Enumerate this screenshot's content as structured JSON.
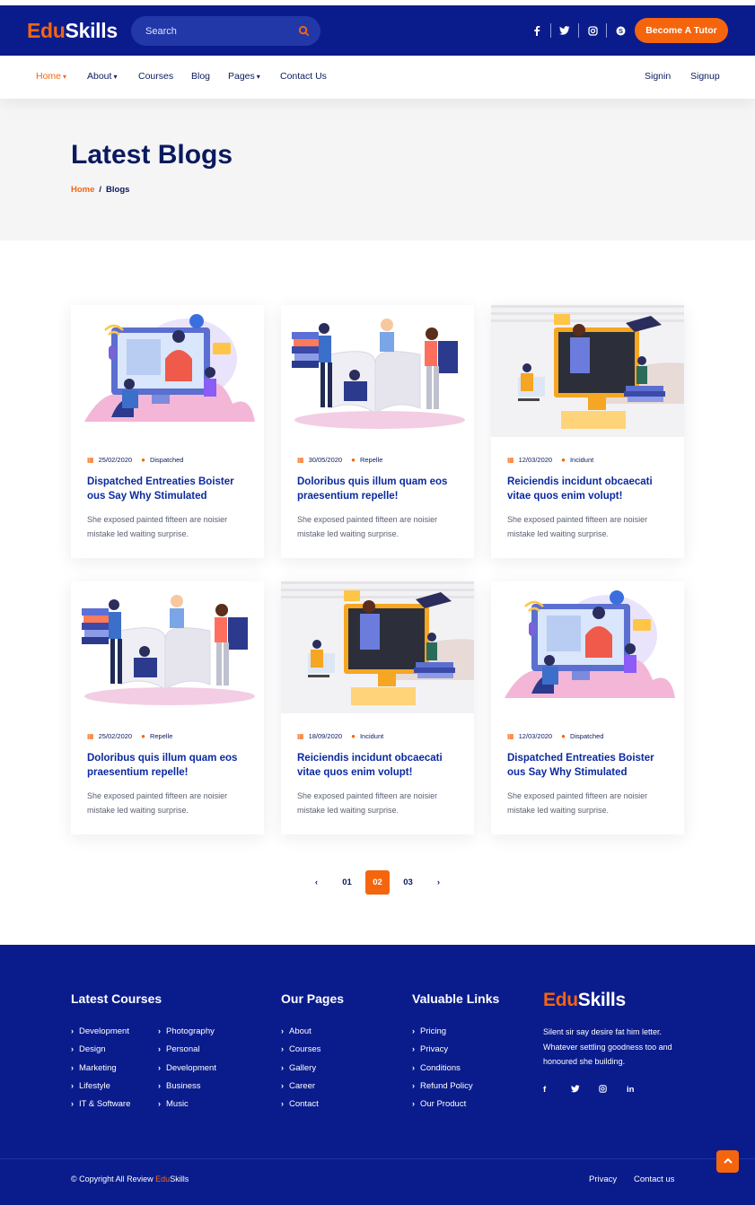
{
  "brand": {
    "edu": "Edu",
    "skills": "Skills"
  },
  "search": {
    "placeholder": "Search"
  },
  "header": {
    "social": [
      "f",
      "t",
      "o",
      "s"
    ],
    "tutor_button": "Become A Tutor"
  },
  "nav": {
    "items": [
      "Home",
      "About",
      "Courses",
      "Blog",
      "Pages",
      "Contact Us"
    ],
    "signin": "Signin",
    "signup": "Signup"
  },
  "hero": {
    "title": "Latest Blogs",
    "breadcrumb_home": "Home",
    "breadcrumb_sep": "/",
    "breadcrumb_current": "Blogs"
  },
  "posts": [
    {
      "date": "25/02/2020",
      "author": "Dispatched",
      "title": "Dispatched Entreaties Boister ous Say Why Stimulated",
      "excerpt": "She exposed painted fifteen are noisier mistake led waiting surprise."
    },
    {
      "date": "30/05/2020",
      "author": "Repelle",
      "title": "Doloribus quis illum quam eos praesentium repelle!",
      "excerpt": "She exposed painted fifteen are noisier mistake led waiting surprise."
    },
    {
      "date": "12/03/2020",
      "author": "Incidunt",
      "title": "Reiciendis incidunt obcaecati vitae quos enim volupt!",
      "excerpt": "She exposed painted fifteen are noisier mistake led waiting surprise."
    },
    {
      "date": "25/02/2020",
      "author": "Repelle",
      "title": "Doloribus quis illum quam eos praesentium repelle!",
      "excerpt": "She exposed painted fifteen are noisier mistake led waiting surprise."
    },
    {
      "date": "18/09/2020",
      "author": "Incidunt",
      "title": "Reiciendis incidunt obcaecati vitae quos enim volupt!",
      "excerpt": "She exposed painted fifteen are noisier mistake led waiting surprise."
    },
    {
      "date": "12/03/2020",
      "author": "Dispatched",
      "title": "Dispatched Entreaties Boister ous Say Why Stimulated",
      "excerpt": "She exposed painted fifteen are noisier mistake led waiting surprise."
    }
  ],
  "pagination": {
    "prev": "‹",
    "pages": [
      "01",
      "02",
      "03"
    ],
    "next": "›",
    "current": "02"
  },
  "footer": {
    "courses_title": "Latest Courses",
    "courses_col1": [
      "Development",
      "Design",
      "Marketing",
      "Lifestyle",
      "IT & Software"
    ],
    "courses_col2": [
      "Photography",
      "Personal",
      "Development",
      "Business",
      "Music"
    ],
    "pages_title": "Our Pages",
    "pages": [
      "About",
      "Courses",
      "Gallery",
      "Career",
      "Contact"
    ],
    "links_title": "Valuable Links",
    "links": [
      "Pricing",
      "Privacy",
      "Conditions",
      "Refund Policy",
      "Our Product"
    ],
    "description": "Silent sir say desire fat him letter. Whatever settling goodness too and honoured she building.",
    "social": [
      "f",
      "t",
      "o",
      "in"
    ],
    "copyright_prefix": "© Copyright All Review ",
    "copyright_edu": "Edu",
    "copyright_skills": "Skills",
    "privacy": "Privacy",
    "contact": "Contact us"
  },
  "colors": {
    "primary": "#0a1c8c",
    "accent": "#f5650e",
    "text_dark": "#0b1a5e",
    "hero_bg": "#f5f5f6"
  }
}
